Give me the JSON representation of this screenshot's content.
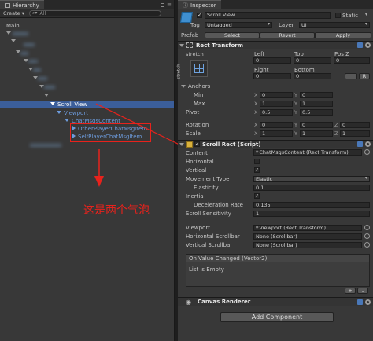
{
  "hierarchy": {
    "tab_label": "Hierarchy",
    "create_label": "Create",
    "search_placeholder": "All",
    "root_label": "Main",
    "scroll_view": "Scroll View",
    "viewport": "Viewport",
    "content": "ChatMsgsContent",
    "item_other": "OtherPlayerChatMsgItem",
    "item_self": "SelfPlayerChatMsgItem"
  },
  "annotation": {
    "text": "这是两个气泡",
    "color": "#e8221c"
  },
  "inspector": {
    "tab_label": "Inspector",
    "object_name": "Scroll View",
    "static_label": "Static",
    "tag_label": "Tag",
    "tag_value": "Untagged",
    "layer_label": "Layer",
    "layer_value": "UI",
    "prefab_label": "Prefab",
    "prefab_select": "Select",
    "prefab_revert": "Revert",
    "prefab_apply": "Apply",
    "rect_transform": {
      "title": "Rect Transform",
      "stretch": "stretch",
      "side_label": "stretch",
      "left_label": "Left",
      "top_label": "Top",
      "posz_label": "Pos Z",
      "left": "0",
      "top": "0",
      "posz": "0",
      "right_label": "Right",
      "bottom_label": "Bottom",
      "right": "0",
      "bottom": "0",
      "r_button": "R",
      "anchors_label": "Anchors",
      "min_label": "Min",
      "min_x": "0",
      "min_y": "0",
      "max_label": "Max",
      "max_x": "1",
      "max_y": "1",
      "pivot_label": "Pivot",
      "pivot_x": "0.5",
      "pivot_y": "0.5",
      "rotation_label": "Rotation",
      "rot_x": "0",
      "rot_y": "0",
      "rot_z": "0",
      "scale_label": "Scale",
      "scale_x": "1",
      "scale_y": "1",
      "scale_z": "1",
      "axis_x": "X",
      "axis_y": "Y",
      "axis_z": "Z"
    },
    "scroll_rect": {
      "title": "Scroll Rect (Script)",
      "content_label": "Content",
      "content_value": "ChatMsgsContent (Rect Transform)",
      "horizontal_label": "Horizontal",
      "vertical_label": "Vertical",
      "movement_label": "Movement Type",
      "movement_value": "Elastic",
      "elasticity_label": "Elasticity",
      "elasticity_value": "0.1",
      "inertia_label": "Inertia",
      "decel_label": "Deceleration Rate",
      "decel_value": "0.135",
      "sensitivity_label": "Scroll Sensitivity",
      "sensitivity_value": "1",
      "viewport_label": "Viewport",
      "viewport_value": "Viewport (Rect Transform)",
      "hscroll_label": "Horizontal Scrollbar",
      "hscroll_value": "None (Scrollbar)",
      "vscroll_label": "Vertical Scrollbar",
      "vscroll_value": "None (Scrollbar)",
      "event_title": "On Value Changed (Vector2)",
      "event_empty": "List is Empty",
      "plus": "+",
      "minus": "-"
    },
    "canvas_renderer": "Canvas Renderer",
    "add_component": "Add Component"
  }
}
